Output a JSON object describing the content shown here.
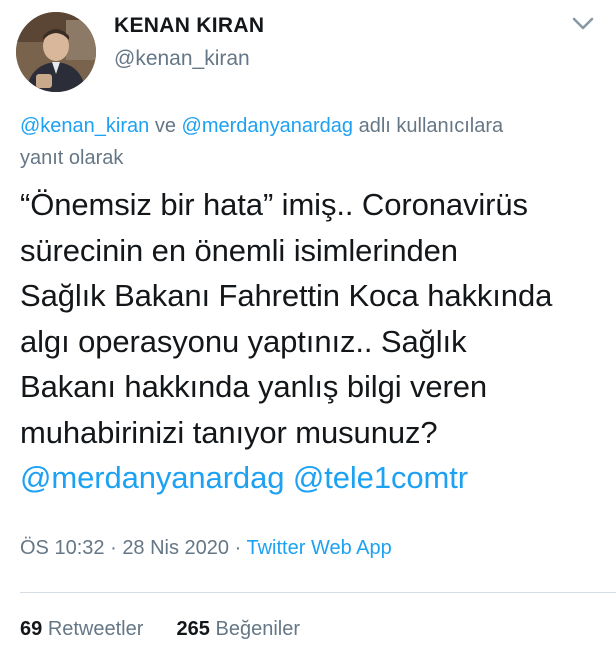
{
  "author": {
    "name": "KENAN KIRAN",
    "handle": "@kenan_kiran"
  },
  "reply": {
    "mention1": "@kenan_kiran",
    "connector": " ve ",
    "mention2": "@merdanyanardag",
    "suffix_line1": " adlı kullanıcılara",
    "suffix_line2": "yanıt olarak"
  },
  "tweet": {
    "lines": [
      "“Önemsiz bir hata” imiş.. Coronavirüs",
      "sürecinin en önemli isimlerinden",
      "Sağlık Bakanı Fahrettin Koca hakkında",
      "algı operasyonu yaptınız.. Sağlık",
      "Bakanı hakkında yanlış bilgi veren",
      "muhabirinizi tanıyor musunuz?"
    ],
    "mention1": "@merdanyanardag",
    "mention2": "@tele1comtr"
  },
  "meta": {
    "time": "ÖS 10:32",
    "date": "28 Nis 2020",
    "separator": "·",
    "source": "Twitter Web App"
  },
  "stats": {
    "retweets_count": "69",
    "retweets_label": "Retweetler",
    "likes_count": "265",
    "likes_label": "Beğeniler"
  },
  "colors": {
    "link": "#1da1f2",
    "secondary_text": "#657786",
    "primary_text": "#14171a"
  },
  "icons": {
    "menu": "chevron-down-icon"
  }
}
